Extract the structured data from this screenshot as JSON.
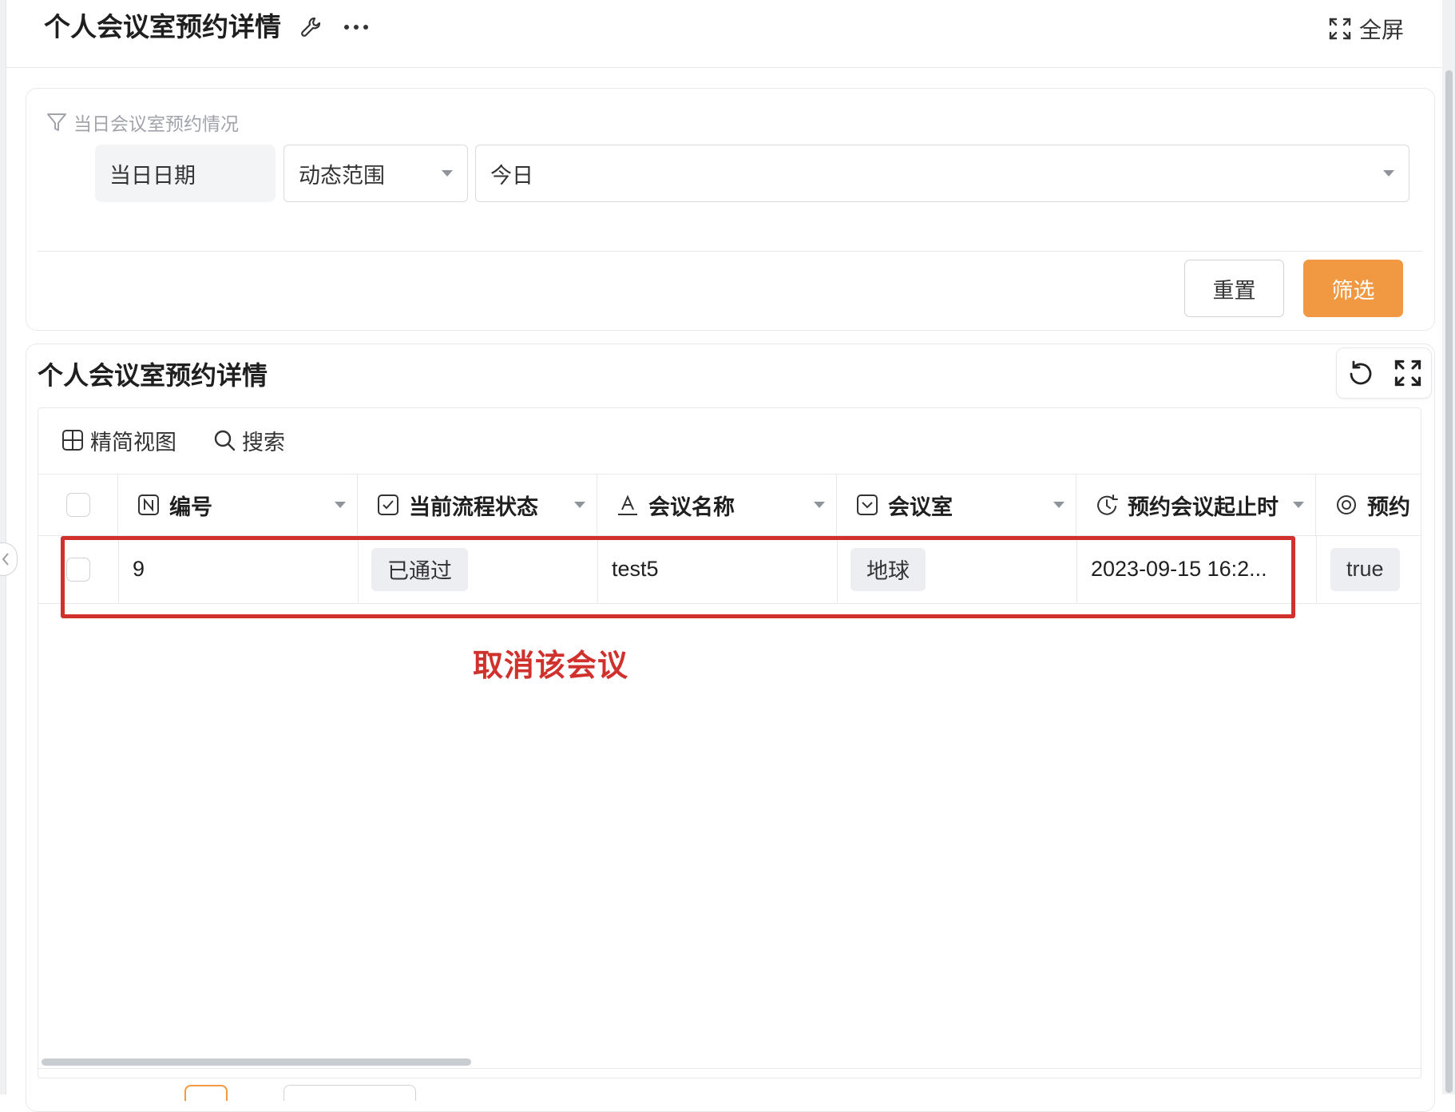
{
  "page": {
    "title": "个人会议室预约详情",
    "fullscreen_label": "全屏"
  },
  "filter": {
    "hint": "当日会议室预约情况",
    "field_label": "当日日期",
    "range_mode": "动态范围",
    "range_value": "今日",
    "reset_label": "重置",
    "submit_label": "筛选"
  },
  "table_section": {
    "title": "个人会议室预约详情",
    "toolbar": {
      "compact_view": "精简视图",
      "search": "搜索"
    },
    "columns": [
      {
        "label": "编号",
        "icon": "number-field-icon"
      },
      {
        "label": "当前流程状态",
        "icon": "checkbox-field-icon"
      },
      {
        "label": "会议名称",
        "icon": "text-field-icon"
      },
      {
        "label": "会议室",
        "icon": "select-field-icon"
      },
      {
        "label": "预约会议起止时",
        "icon": "datetime-field-icon"
      },
      {
        "label": "预约",
        "icon": "radio-field-icon"
      }
    ],
    "rows": [
      {
        "id": "9",
        "status": "已通过",
        "meeting_name": "test5",
        "room": "地球",
        "time": "2023-09-15 16:2...",
        "flag": "true"
      }
    ]
  },
  "annotation": {
    "text": "取消该会议",
    "color": "#d0312d"
  },
  "colors": {
    "accent": "#f09942",
    "border": "#e6e8eb",
    "tag_bg": "#eceef1"
  }
}
